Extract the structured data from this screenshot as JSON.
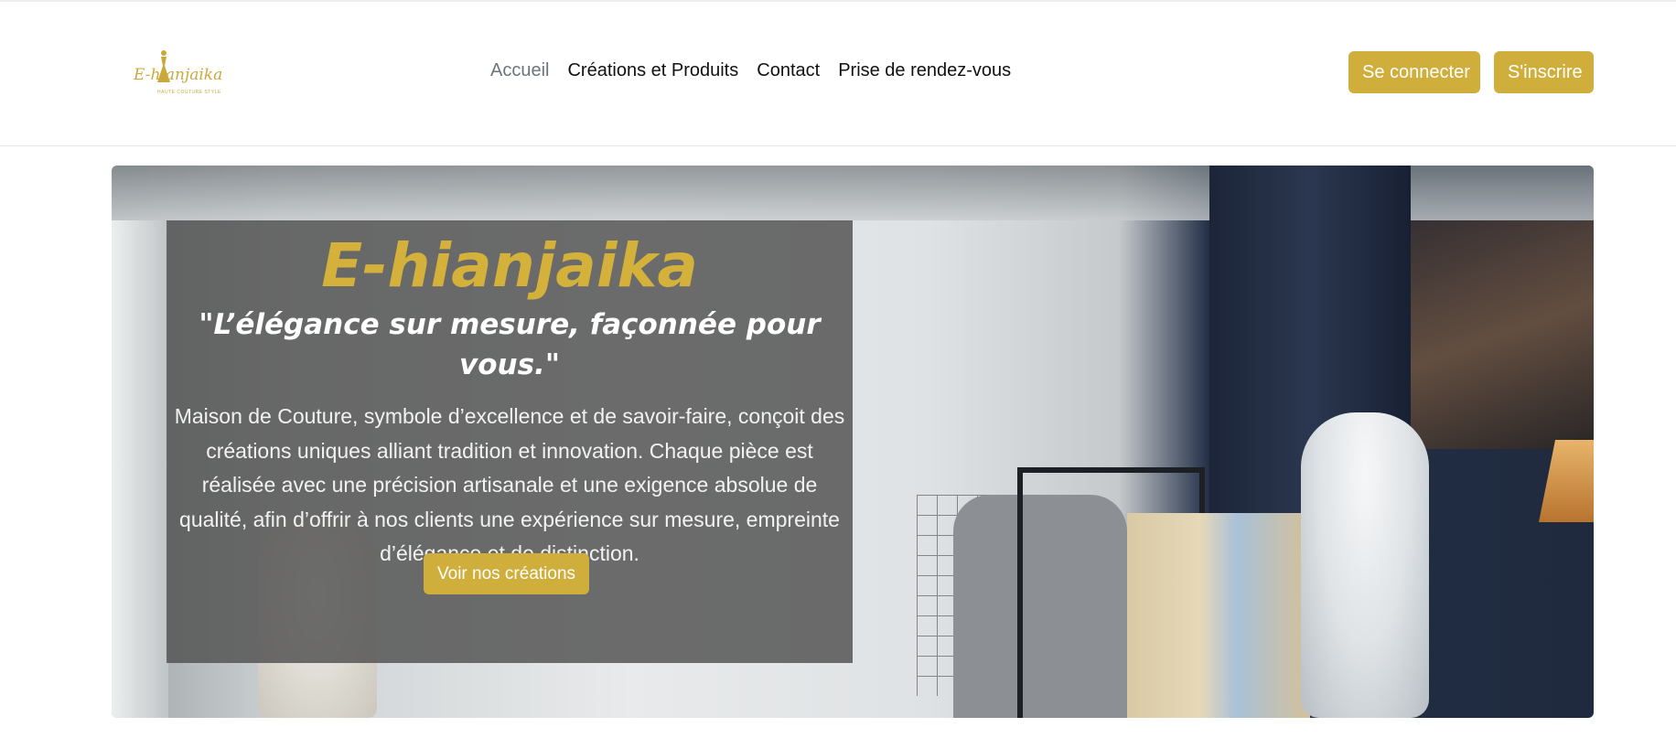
{
  "brand": {
    "logo_text": "E-hianjaika",
    "logo_subtext": "HAUTE COUTURE STYLE",
    "accent_color": "#cfae3c"
  },
  "nav": {
    "items": [
      {
        "label": "Accueil",
        "active": true
      },
      {
        "label": "Créations et Produits",
        "active": false
      },
      {
        "label": "Contact",
        "active": false
      },
      {
        "label": "Prise de rendez-vous",
        "active": false
      }
    ]
  },
  "auth": {
    "login_label": "Se connecter",
    "signup_label": "S'inscrire"
  },
  "hero": {
    "title": "E-hianjaika",
    "tagline": "\"L’élégance sur mesure, façonnée pour vous.\"",
    "description": "Maison de Couture, symbole d’excellence et de savoir-faire, conçoit des créations uniques alliant tradition et innovation. Chaque pièce est réalisée avec une précision artisanale et une exigence absolue de qualité, afin d’offrir à nos clients une expérience sur mesure, empreinte d’élégance et de distinction.",
    "cta_label": "Voir nos créations",
    "background_image": "couture-atelier-photo"
  }
}
